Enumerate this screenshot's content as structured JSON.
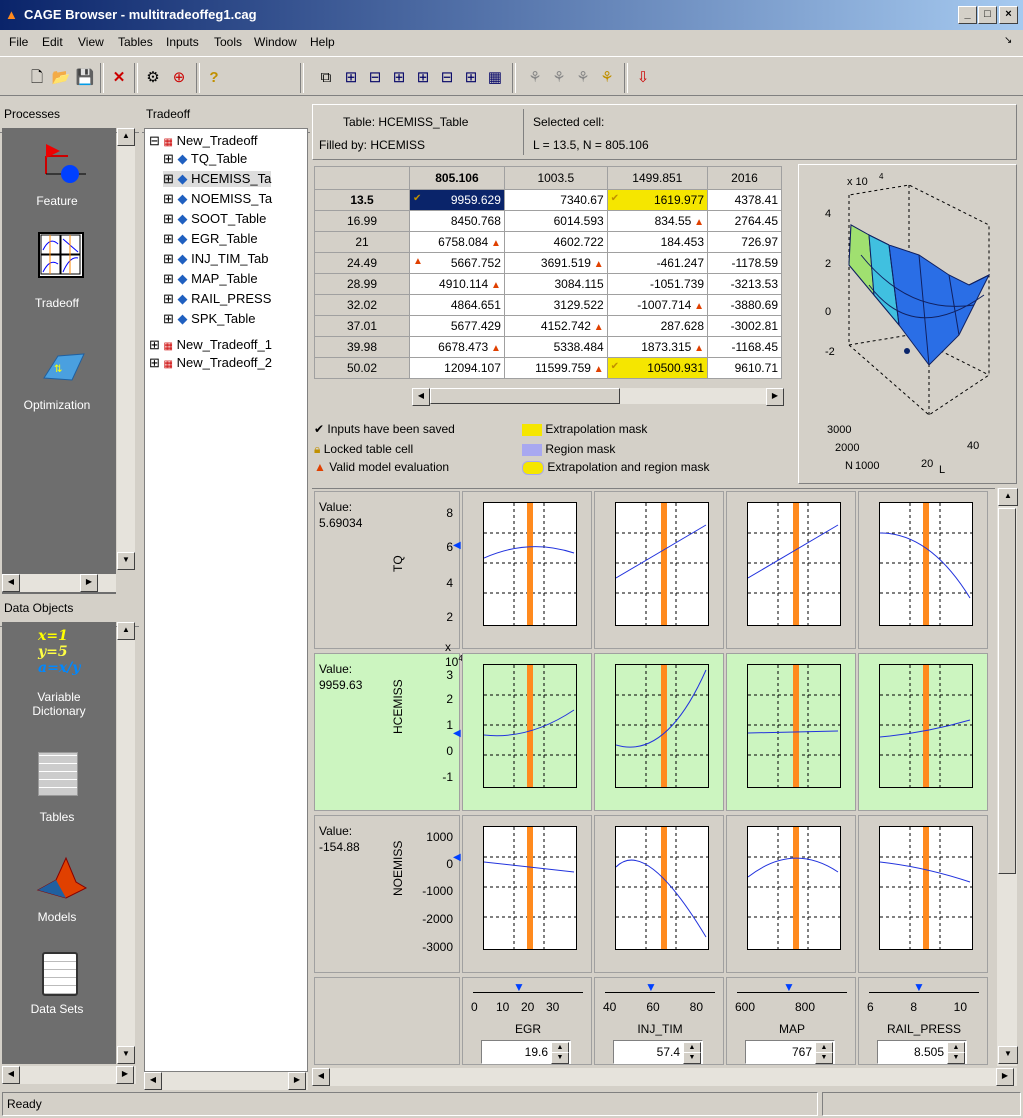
{
  "window": {
    "title": "CAGE Browser - multitradeoffeg1.cag"
  },
  "menu": [
    "File",
    "Edit",
    "View",
    "Tables",
    "Inputs",
    "Tools",
    "Window",
    "Help"
  ],
  "panels": {
    "processes_title": "Processes",
    "tradeoff_title": "Tradeoff",
    "data_objects_title": "Data Objects"
  },
  "processes": [
    {
      "label": "Feature"
    },
    {
      "label": "Tradeoff"
    },
    {
      "label": "Optimization"
    }
  ],
  "data_objects": [
    {
      "label": "Variable Dictionary"
    },
    {
      "label": "Tables"
    },
    {
      "label": "Models"
    },
    {
      "label": "Data Sets"
    }
  ],
  "tree": {
    "root1": "New_Tradeoff",
    "children": [
      "TQ_Table",
      "HCEMISS_Ta",
      "NOEMISS_Ta",
      "SOOT_Table",
      "EGR_Table",
      "INJ_TIM_Tab",
      "MAP_Table",
      "RAIL_PRESS",
      "SPK_Table"
    ],
    "root2": "New_Tradeoff_1",
    "root3": "New_Tradeoff_2"
  },
  "info": {
    "table": "Table:  HCEMISS_Table",
    "filled_by": "Filled by:  HCEMISS",
    "selected_cell": "Selected cell:",
    "cell_coords": "L = 13.5, N = 805.106"
  },
  "table": {
    "columns": [
      "805.106",
      "1003.5",
      "1499.851",
      "2016"
    ],
    "rows": [
      {
        "h": "13.5",
        "c": [
          "9959.629",
          "7340.67",
          "1619.977",
          "4378.41"
        ]
      },
      {
        "h": "16.99",
        "c": [
          "8450.768",
          "6014.593",
          "834.55",
          "2764.45"
        ]
      },
      {
        "h": "21",
        "c": [
          "6758.084",
          "4602.722",
          "184.453",
          "726.97"
        ]
      },
      {
        "h": "24.49",
        "c": [
          "5667.752",
          "3691.519",
          "-461.247",
          "-1178.59"
        ]
      },
      {
        "h": "28.99",
        "c": [
          "4910.114",
          "3084.115",
          "-1051.739",
          "-3213.53"
        ]
      },
      {
        "h": "32.02",
        "c": [
          "4864.651",
          "3129.522",
          "-1007.714",
          "-3880.69"
        ]
      },
      {
        "h": "37.01",
        "c": [
          "5677.429",
          "4152.742",
          "287.628",
          "-3002.81"
        ]
      },
      {
        "h": "39.98",
        "c": [
          "6678.473",
          "5338.484",
          "1873.315",
          "-1168.45"
        ]
      },
      {
        "h": "50.02",
        "c": [
          "12094.107",
          "11599.759",
          "10500.931",
          "9610.71"
        ]
      }
    ]
  },
  "legend": {
    "saved": "Inputs have been saved",
    "locked": "Locked table cell",
    "valid": "Valid model evaluation",
    "extrap": "Extrapolation mask",
    "region": "Region mask",
    "both": "Extrapolation and region mask",
    "extrap_color": "#f5e600",
    "region_color": "#a8a8f0"
  },
  "surface": {
    "exp": "x 10",
    "exp_power": "4",
    "z_ticks": [
      "4",
      "2",
      "0",
      "-2"
    ],
    "n_ticks": [
      "3000",
      "2000",
      "1000"
    ],
    "n_label": "N",
    "l_ticks": [
      "40",
      "20"
    ],
    "l_label": "L"
  },
  "rows": [
    {
      "value_label": "Value:",
      "value": "5.69034",
      "ylabel": "TQ",
      "ticks": [
        "8",
        "6",
        "4",
        "2"
      ],
      "exp": ""
    },
    {
      "value_label": "Value:",
      "value": "9959.63",
      "ylabel": "HCEMISS",
      "ticks": [
        "3",
        "2",
        "1",
        "0",
        "-1"
      ],
      "exp": "x 10",
      "exp_power": "4"
    },
    {
      "value_label": "Value:",
      "value": "-154.88",
      "ylabel": "NOEMISS",
      "ticks": [
        "1000",
        "0",
        "-1000",
        "-2000",
        "-3000"
      ],
      "exp": ""
    }
  ],
  "inputs": [
    {
      "name": "EGR",
      "ticks": [
        "0",
        "10",
        "20",
        "30"
      ],
      "value": "19.6"
    },
    {
      "name": "INJ_TIM",
      "ticks": [
        "40",
        "60",
        "80"
      ],
      "value": "57.4"
    },
    {
      "name": "MAP",
      "ticks": [
        "600",
        "800"
      ],
      "value": "767"
    },
    {
      "name": "RAIL_PRESS",
      "ticks": [
        "6",
        "8",
        "10"
      ],
      "value": "8.505"
    }
  ],
  "status": "Ready",
  "colors": {
    "selected": "#0a246a",
    "orange": "#ff8a1e",
    "green": "#ccf5c0",
    "curve": "#2233dd"
  }
}
